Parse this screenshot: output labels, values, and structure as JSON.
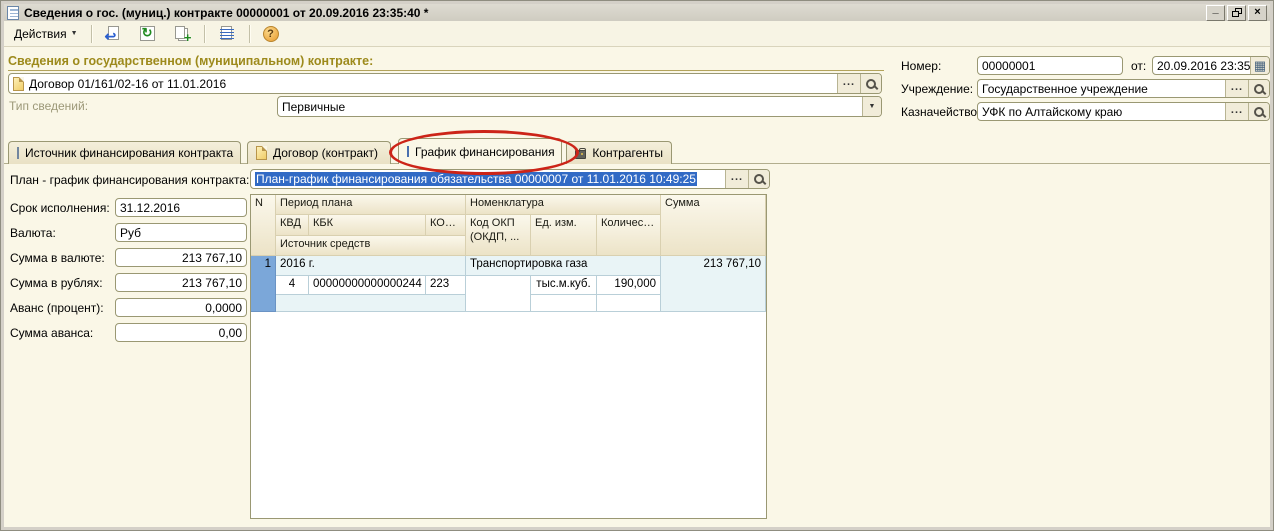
{
  "titlebar": {
    "title": "Сведения о гос. (муниц.) контракте 00000001 от 20.09.2016 23:35:40 *"
  },
  "glyphs": {
    "dropdown": "▼",
    "ellipsis": "...",
    "minimize": "_",
    "close": "×",
    "calendar": "▦",
    "help": "?",
    "post_arrow": "↩",
    "refresh": "↻",
    "plus": "+"
  },
  "toolbar": {
    "actions_label": "Действия"
  },
  "header": {
    "group_title": "Сведения о государственном (муниципальном) контракте:",
    "contract_value": "Договор 01/161/02-16 от 11.01.2016",
    "type_label": "Тип сведений:",
    "type_value": "Первичные",
    "number_label": "Номер:",
    "number_value": "00000001",
    "from_label": "от:",
    "date_value": "20.09.2016 23:35:40",
    "institution_label": "Учреждение:",
    "institution_value": "Государственное учреждение",
    "treasury_label": "Казначейство:",
    "treasury_value": "УФК по Алтайскому краю"
  },
  "tabs": {
    "source": "Источник финансирования контракта",
    "contract": "Договор (контракт)",
    "schedule": "График финансирования",
    "counterparties": "Контрагенты"
  },
  "annotation": {
    "type": "red-oval-highlight",
    "target_tab": "График финансирования",
    "color": "#cc2418"
  },
  "plan": {
    "label": "План - график финансирования контракта:",
    "value": "План-график финансирования обязательства 00000007 от 11.01.2016 10:49:25",
    "selected": true
  },
  "left_fields": {
    "term": {
      "label": "Срок исполнения:",
      "value": "31.12.2016"
    },
    "currency": {
      "label": "Валюта:",
      "value": "Руб"
    },
    "amount_currency": {
      "label": "Сумма в валюте:",
      "value": "213 767,10"
    },
    "amount_rub": {
      "label": "Сумма в рублях:",
      "value": "213 767,10"
    },
    "advance_pct": {
      "label": "Аванс (процент):",
      "value": "0,0000"
    },
    "advance_sum": {
      "label": "Сумма аванса:",
      "value": "0,00"
    }
  },
  "table": {
    "header": {
      "n": "N",
      "period": "Период плана",
      "nomenclature": "Номенклатура",
      "sum": "Сумма",
      "kvd": "КВД",
      "kbk": "КБК",
      "kosgu": "КОС...",
      "okp": "Код ОКП (ОКДП,  ...",
      "unit": "Ед. изм.",
      "qty": "Количест...",
      "source": "Источник средств"
    },
    "row": {
      "n": "1",
      "period": "2016 г.",
      "nomenclature": "Транспортировка газа",
      "sum": "213 767,10",
      "kvd": "4",
      "kbk": "00000000000000244",
      "kosgu": "223",
      "unit": "тыс.м.куб.",
      "qty": "190,000"
    }
  },
  "colors": {
    "window_bg": "#faf7e7",
    "frame": "#d4d0c8",
    "group_title": "#9d8a1c",
    "selection_blue": "#316ac5",
    "row_marker_blue": "#7ba7d9",
    "row_azure": "#e9f4f6",
    "annotation_red": "#cc2418"
  }
}
